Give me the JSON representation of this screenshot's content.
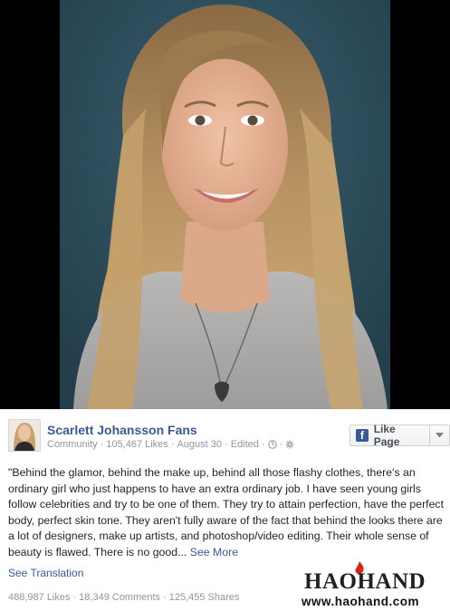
{
  "post": {
    "page_name": "Scarlett Johansson Fans",
    "meta": {
      "category": "Community",
      "likes": "105,467 Likes",
      "date": "August 30",
      "edited": "Edited"
    },
    "like_button_label": "Like Page",
    "body_text": "\"Behind the glamor, behind the make up, behind all those flashy clothes, there's an ordinary girl who just happens to have an extra ordinary job. I have seen young girls follow celebrities and try to be one of them. They try to attain perfection, have the perfect body, perfect skin tone. They aren't fully aware of the fact that behind the looks there are a lot of designers, make up artists, and photoshop/video editing. Their whole sense of beauty is flawed. There is no good...",
    "see_more_label": "See More",
    "see_translation_label": "See Translation",
    "stats": {
      "likes": "488,987 Likes",
      "comments": "18,349 Comments",
      "shares": "125,455 Shares"
    }
  },
  "watermark": {
    "logo_text": "HAOHAND",
    "url": "www.haohand.com"
  },
  "colors": {
    "link_blue": "#3b5998",
    "meta_gray": "#90949c",
    "text_dark": "#1d2129",
    "photo_backdrop": "#2f4f5e"
  },
  "icons": [
    "globe-icon",
    "settings-icon",
    "facebook-logo-icon",
    "chevron-down-icon"
  ]
}
